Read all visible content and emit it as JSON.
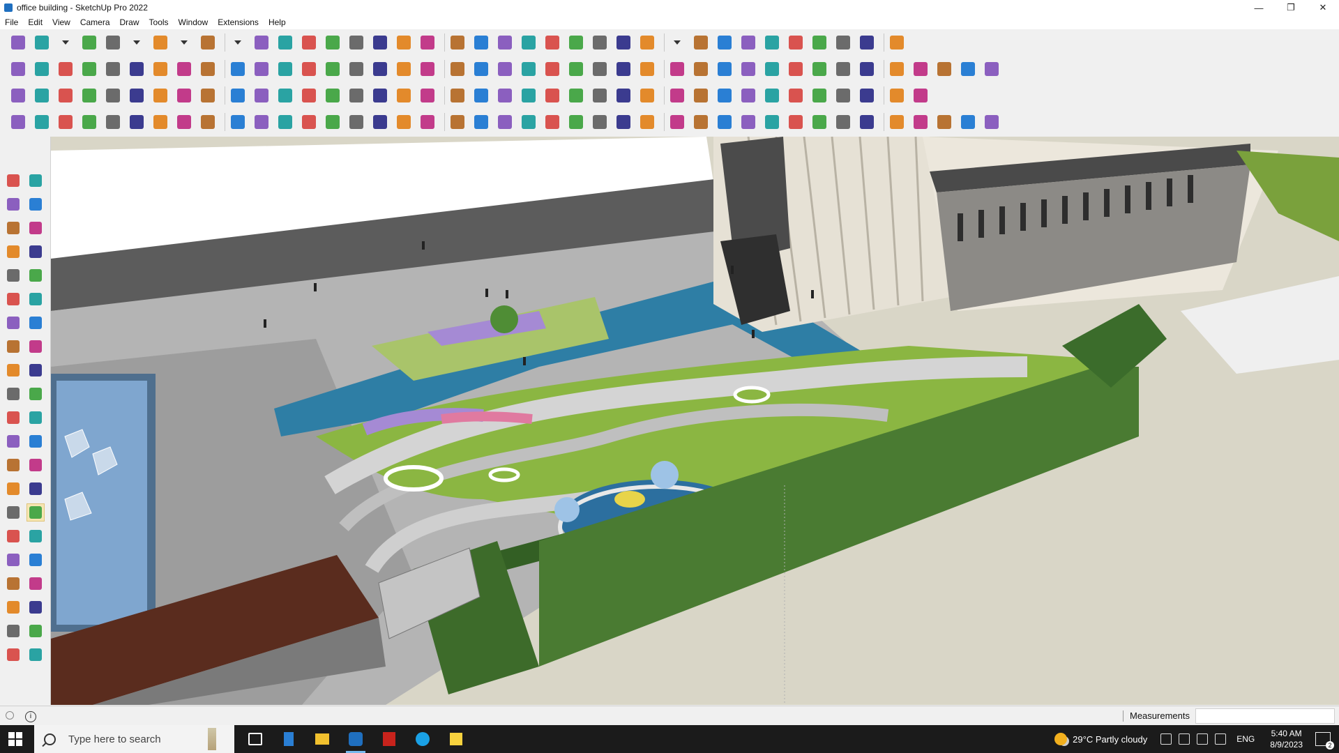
{
  "window": {
    "title": "office building - SketchUp Pro 2022",
    "minimize_glyph": "—",
    "maximize_glyph": "❐",
    "close_glyph": "✕"
  },
  "menu": [
    "File",
    "Edit",
    "View",
    "Camera",
    "Draw",
    "Tools",
    "Window",
    "Extensions",
    "Help"
  ],
  "toolbars": {
    "row1_icons": [
      "zoom-icon",
      "select-icon",
      "select-dropdown-icon",
      "eraser-icon",
      "pencil-icon",
      "pencil-dropdown-icon",
      "arc-icon",
      "arc-dropdown-icon",
      "shape-icon",
      "shape-dropdown-icon",
      "push-pull-icon",
      "follow-me-icon",
      "move-icon",
      "rotate-icon",
      "scale-icon",
      "tape-measure-icon",
      "text-icon",
      "paint-bucket-icon",
      "orbit-icon",
      "pan-icon",
      "zoom-tool-icon",
      "zoom-extents-icon",
      "outer-shell-icon",
      "intersect-icon",
      "union-icon",
      "subtract-icon",
      "warehouse-icon",
      "warehouse-dropdown-icon",
      "extension-icon",
      "component-icon",
      "section-icon",
      "up-down-icon",
      "flip-icon",
      "export-icon",
      "undo-icon",
      "redo-icon",
      "hand-icon"
    ],
    "row2_icons": [
      "box-icon",
      "xray-icon",
      "back-edges-icon",
      "push-icon",
      "face-icon",
      "sandbox-icon",
      "arrow-red-icon",
      "arrow-green-icon",
      "arrow-blue-icon",
      "arrow-orange-icon",
      "arrow-pink-icon",
      "smooth-icon",
      "glass-icon",
      "window-icon",
      "door-icon",
      "house-icon",
      "roof-icon",
      "gable-icon",
      "chimney-icon",
      "fx-icon",
      "leaf-icon",
      "paintbrush-icon",
      "poly-icon",
      "ellipse-icon",
      "hexagon-icon",
      "oval-icon",
      "parallelogram-icon",
      "curve-icon",
      "loop-icon",
      "bezier-icon",
      "spline-icon",
      "cut-icon",
      "knife-icon",
      "weld-icon",
      "flare-icon",
      "brick-icon",
      "stack-icon",
      "stair-icon",
      "glove-icon",
      "texture-icon",
      "roofline-icon"
    ],
    "row3_icons": [
      "plane-blue-icon",
      "plane-cyan-icon",
      "plane-yellow-icon",
      "plane-green-icon",
      "plane-red-icon",
      "plane-white-icon",
      "rotate-orange-icon",
      "square-red-icon",
      "grid-icon",
      "flag-icon",
      "crate-icon",
      "pipe-icon",
      "bend-icon",
      "joint-icon",
      "plus-red-icon",
      "plus-green-icon",
      "cross-blue-icon",
      "cone-icon",
      "pyramid-icon",
      "warning-icon",
      "lasso-icon",
      "knot-icon",
      "chain-icon",
      "axis-icon",
      "bag-icon",
      "magnet-icon",
      "leaf-tree-icon",
      "gear-red-icon",
      "chair-icon",
      "bed-icon",
      "pile-icon",
      "roof-tile-icon",
      "panel-orange-icon",
      "window-orange-icon",
      "window-yellow-icon",
      "cross-red-icon",
      "dots-icon",
      "component-grid-icon"
    ],
    "row4_icons": [
      "curve-edit-icon",
      "polyline-icon",
      "truck-icon",
      "scissors-icon",
      "gear-outline-icon",
      "loft-icon",
      "spring-icon",
      "torus-icon",
      "sphere-icon",
      "surface-icon",
      "line-bend-icon",
      "corner-icon",
      "corner-red-icon",
      "beam-icon",
      "fillet-icon",
      "frame-icon",
      "cone-outline-icon",
      "column-icon",
      "bar-icon",
      "disk-icon",
      "tube-icon",
      "shear-icon",
      "layers-icon",
      "slash-icon",
      "rail-icon",
      "rail-2-icon",
      "rail-3-icon",
      "brick-wall-icon",
      "wall-icon",
      "vent-icon",
      "fence-icon",
      "steps-icon",
      "mesh-icon",
      "grid-fill-icon",
      "rake-icon",
      "wave-icon",
      "wave-2-icon",
      "slope-icon",
      "spring-2-icon",
      "dome-icon",
      "box-outline-icon"
    ]
  },
  "palette_icons": [
    "select-icon",
    "orbit-icon",
    "paint-bucket-icon",
    "eraser-icon",
    "component-icon",
    "tape-icon",
    "pencil-icon",
    "freehand-icon",
    "rectangle-icon",
    "rotated-rect-icon",
    "circle-icon",
    "polygon-icon",
    "arc-icon",
    "arc-2-icon",
    "pie-icon",
    "arc-3-icon",
    "move-icon",
    "push-pull-icon",
    "rotate-icon",
    "follow-me-icon",
    "scale-icon",
    "offset-icon",
    "tape-measure-icon",
    "dimension-icon",
    "protractor-icon",
    "text-icon",
    "axes-icon",
    "3d-text-icon",
    "orbit-2-icon",
    "pan-icon",
    "zoom-icon",
    "zoom-window-icon",
    "zoom-extents-icon",
    "previous-view-icon",
    "walk-icon",
    "look-around-icon",
    "footprints-icon",
    "position-camera-icon",
    "outer-shell-icon",
    "intersect-icon",
    "union-icon",
    "trim-icon"
  ],
  "status": {
    "info_glyph": "i",
    "measurements_label": "Measurements",
    "measurements_value": ""
  },
  "taskbar": {
    "search_placeholder": "Type here to search",
    "weather_temp": "29°C",
    "weather_desc": "Partly cloudy",
    "language": "ENG",
    "time": "5:40 AM",
    "date": "8/9/2023",
    "notification_count": "2"
  },
  "colors": {
    "toolbar_bg": "#f0f0f0",
    "selected_tool": "#f6e6b2",
    "taskbar_bg": "#1b1b1b",
    "grass": "#8bb642",
    "water": "#2c7fa6",
    "paving": "#a8a8a8",
    "hedge": "#3d6b2a"
  }
}
